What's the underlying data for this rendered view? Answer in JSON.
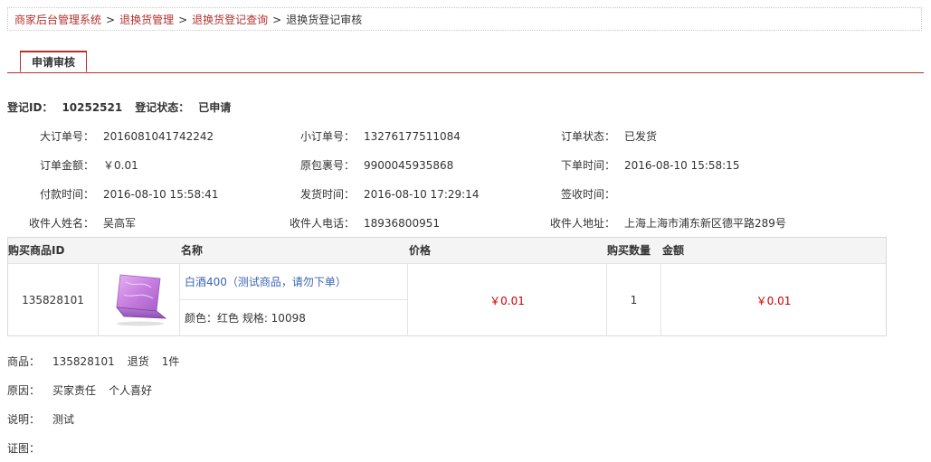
{
  "breadcrumb": {
    "items": [
      "商家后台管理系统",
      "退换货管理",
      "退换货登记查询"
    ],
    "current": "退换货登记审核",
    "separator": ">"
  },
  "tab": {
    "label": "申请审核"
  },
  "registration": {
    "id_label": "登记ID：",
    "id_value": "10252521",
    "status_label": "登记状态：",
    "status_value": "已申请"
  },
  "order_info": [
    [
      {
        "label": "大订单号：",
        "value": "2016081041742242"
      },
      {
        "label": "小订单号：",
        "value": "13276177511084"
      },
      {
        "label": "订单状态：",
        "value": "已发货"
      }
    ],
    [
      {
        "label": "订单金额：",
        "value": "￥0.01"
      },
      {
        "label": "原包裹号：",
        "value": "9900045935868"
      },
      {
        "label": "下单时间：",
        "value": "2016-08-10 15:58:15"
      }
    ],
    [
      {
        "label": "付款时间：",
        "value": "2016-08-10 15:58:41"
      },
      {
        "label": "发货时间：",
        "value": "2016-08-10 17:29:14"
      },
      {
        "label": "签收时间：",
        "value": ""
      }
    ],
    [
      {
        "label": "收件人姓名：",
        "value": "吴高军"
      },
      {
        "label": "收件人电话：",
        "value": "18936800951"
      },
      {
        "label": "收件人地址：",
        "value": "上海上海市浦东新区德平路289号"
      }
    ]
  ],
  "goods_table": {
    "headers": [
      "购买商品ID",
      "名称",
      "价格",
      "购买数量",
      "金额"
    ],
    "row": {
      "product_id": "135828101",
      "thumbnail_icon": "laptop-thumbnail",
      "name": "白酒400（测试商品，请勿下单）",
      "spec": "颜色：红色 规格: 10098",
      "price": "￥0.01",
      "quantity": "1",
      "amount": "￥0.01"
    }
  },
  "return_detail": {
    "goods_label": "商品：",
    "goods_id": "135828101",
    "type": "退货",
    "count": "1件",
    "reason_label": "原因：",
    "reason_party": "买家责任",
    "reason_text": "个人喜好",
    "note_label": "说明：",
    "note_text": "测试",
    "evidence_label": "证图："
  },
  "colors": {
    "accent": "#b3312c",
    "price": "#cc0000",
    "link": "#3b66b5"
  }
}
